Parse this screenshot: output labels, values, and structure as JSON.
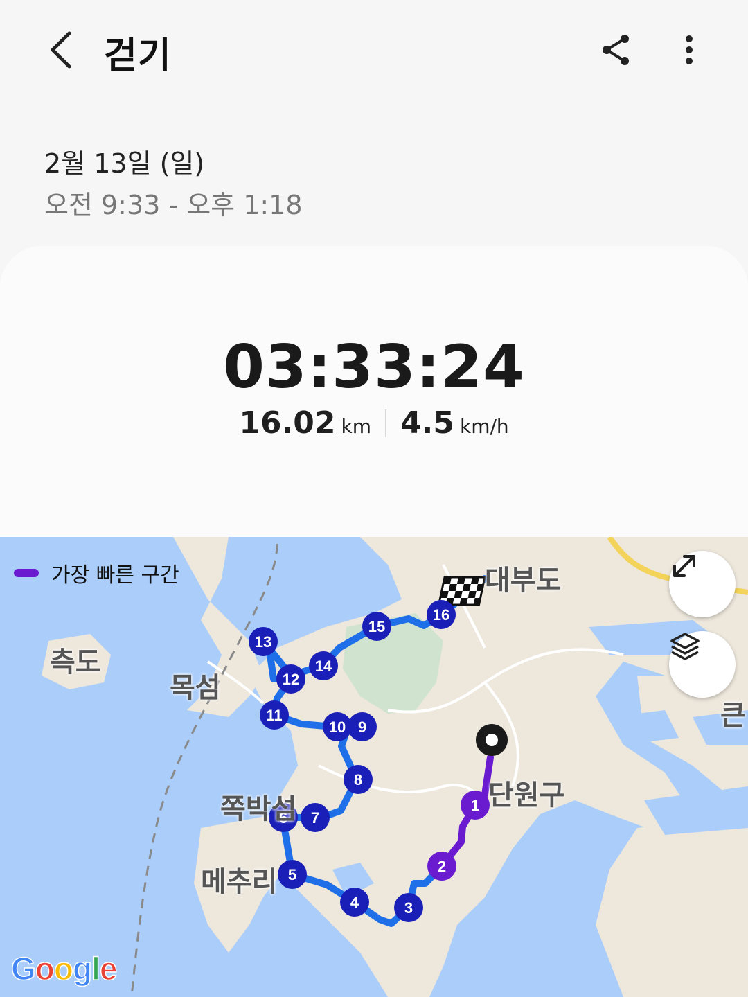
{
  "header": {
    "title": "걷기",
    "back_icon": "chevron-left-icon",
    "share_icon": "share-icon",
    "more_icon": "more-vertical-icon"
  },
  "session": {
    "date": "2월 13일 (일)",
    "time_range": "오전 9:33 - 오후 1:18"
  },
  "summary": {
    "duration": "03:33:24",
    "distance_value": "16.02",
    "distance_unit": "km",
    "speed_value": "4.5",
    "speed_unit": "km/h"
  },
  "map": {
    "legend_label": "가장 빠른 구간",
    "legend_color": "#6a1bd0",
    "route_color": "#1f6fe8",
    "marker_color": "#1a1fb8",
    "fast_marker_color": "#6a1bd0",
    "expand_icon": "expand-icon",
    "layers_icon": "layers-icon",
    "start_icon": "start-pin-icon",
    "finish_icon": "checkered-flag-icon",
    "attribution": "Google",
    "place_labels": [
      "대부도",
      "측도",
      "목섬",
      "쪽박섬",
      "메추리",
      "단원구",
      "큰"
    ],
    "markers": [
      "1",
      "2",
      "3",
      "4",
      "5",
      "6",
      "7",
      "8",
      "9",
      "10",
      "11",
      "12",
      "13",
      "14",
      "15",
      "16"
    ]
  }
}
